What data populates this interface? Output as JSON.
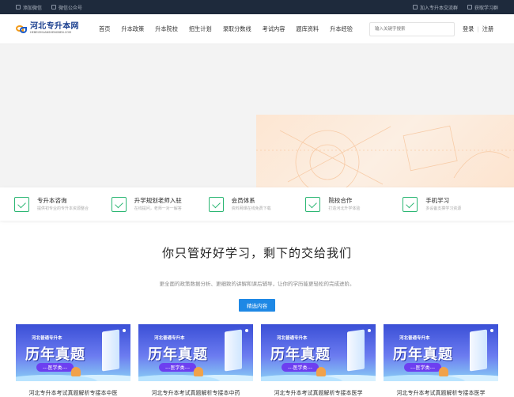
{
  "topbar": {
    "left": [
      "添加微信",
      "微信公众号"
    ],
    "right": [
      "加入专升本交流群",
      "获取学习群"
    ]
  },
  "header": {
    "logo_cn": "河北专升本网",
    "logo_en": "HEBEIZHUANSHENGBEN.COM",
    "nav": [
      "首页",
      "升本政策",
      "升本院校",
      "招生计划",
      "录取分数线",
      "考试内容",
      "题库资料",
      "升本经验"
    ],
    "search_placeholder": "输入关键字搜索",
    "login": "登录",
    "register": "注册"
  },
  "features": [
    {
      "title": "专升本咨询",
      "desc": "提供初专业的专升本资源整合"
    },
    {
      "title": "升学规划老师入驻",
      "desc": "在线提问，老师一对一解答"
    },
    {
      "title": "会员体系",
      "desc": "资料网课在线免费下载"
    },
    {
      "title": "院校合作",
      "desc": "打造河北升学体验"
    },
    {
      "title": "手机学习",
      "desc": "多设备支撑学习资源"
    }
  ],
  "slogan": {
    "title": "你只管好好学习，剩下的交给我们",
    "subtitle": "更全面的政策数据分析、更细致的讲解和课后辅导，让你的学历能更轻松的完成进阶。",
    "button": "精选内容"
  },
  "cards": [
    {
      "badge": "河北普通专升本",
      "headline": "历年真题",
      "tag": "---医学类---",
      "title": "河北专升本考试真题解析专接本中医"
    },
    {
      "badge": "河北普通专升本",
      "headline": "历年真题",
      "tag": "---医学类---",
      "title": "河北专升本考试真题解析专接本中药"
    },
    {
      "badge": "河北普通专升本",
      "headline": "历年真题",
      "tag": "---医学类---",
      "title": "河北专升本考试真题解析专接本医学"
    },
    {
      "badge": "河北普通专升本",
      "headline": "历年真题",
      "tag": "---医学类---",
      "title": "河北专升本考试真题解析专接本医学"
    }
  ],
  "colors": {
    "accent": "#1e88e5",
    "feature_icon": "#2bb673",
    "topbar": "#1e2a3c",
    "logo": "#1a3f8f"
  }
}
